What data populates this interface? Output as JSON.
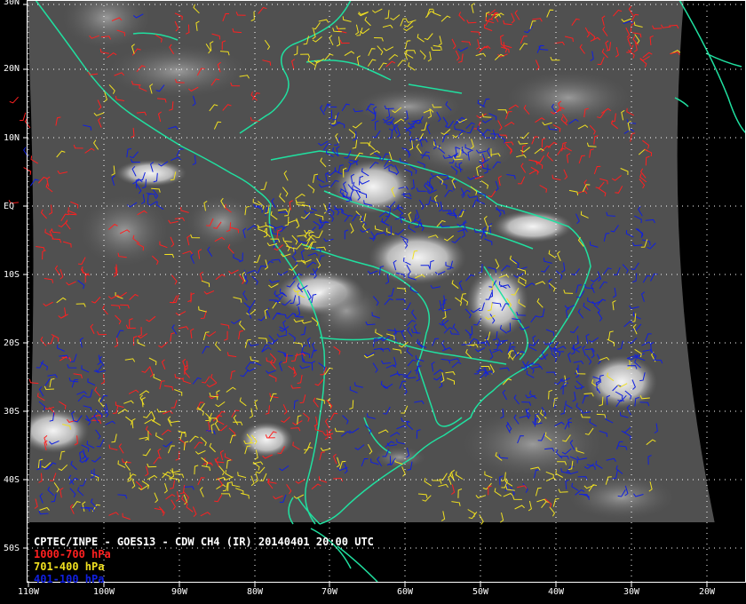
{
  "title": "CPTEC/INPE - GOES13 - CDW CH4 (IR) 20140401 20:00 UTC",
  "legend": [
    {
      "label": "1000-700 hPa",
      "color": "#ff2020"
    },
    {
      "label": "701-400 hPa",
      "color": "#f0e020"
    },
    {
      "label": "401-100 hPa",
      "color": "#1020e0"
    }
  ],
  "lat_labels": [
    "30N",
    "20N",
    "10N",
    "EQ",
    "10S",
    "20S",
    "30S",
    "40S",
    "50S"
  ],
  "lon_labels": [
    "110W",
    "100W",
    "90W",
    "80W",
    "70W",
    "60W",
    "50W",
    "40W",
    "30W",
    "20W"
  ],
  "colors": {
    "coastline": "#20e0a0",
    "grid": "#ffffff",
    "background": "#000000"
  }
}
